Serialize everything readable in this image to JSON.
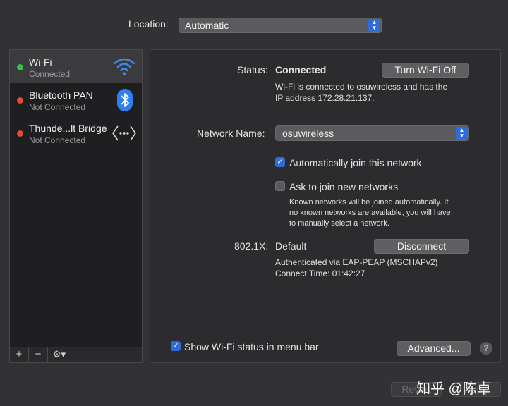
{
  "location": {
    "label": "Location:",
    "value": "Automatic"
  },
  "sidebar": {
    "items": [
      {
        "name": "Wi-Fi",
        "status": "Connected"
      },
      {
        "name": "Bluetooth PAN",
        "status": "Not Connected"
      },
      {
        "name": "Thunde...lt Bridge",
        "status": "Not Connected"
      }
    ],
    "add_label": "+",
    "remove_label": "−",
    "gear_label": "⚙▾"
  },
  "status": {
    "label": "Status:",
    "value": "Connected",
    "toggle_button": "Turn Wi-Fi Off",
    "description_line1": "Wi-Fi is connected to osuwireless and has the",
    "description_line2": "IP address 172.28.21.137."
  },
  "network": {
    "label": "Network Name:",
    "value": "osuwireless",
    "auto_join": {
      "label": "Automatically join this network",
      "checked": true
    },
    "ask_join": {
      "label": "Ask to join new networks",
      "checked": false
    },
    "note_line1": "Known networks will be joined automatically. If",
    "note_line2": "no known networks are available, you will have",
    "note_line3": "to manually select a network."
  },
  "dot1x": {
    "label": "802.1X:",
    "value": "Default",
    "disconnect_button": "Disconnect",
    "auth_line": "Authenticated via EAP-PEAP (MSCHAPv2)",
    "connect_time": "Connect Time: 01:42:27"
  },
  "footer": {
    "show_status": {
      "label": "Show Wi-Fi status in menu bar",
      "checked": true
    },
    "advanced_button": "Advanced...",
    "help": "?",
    "revert_button": "Revert",
    "apply_button": "Apply"
  },
  "watermark": "知乎 @陈卓",
  "colors": {
    "accent": "#2f6bdc",
    "connected": "#35c14a",
    "disconnected": "#e34a42"
  }
}
